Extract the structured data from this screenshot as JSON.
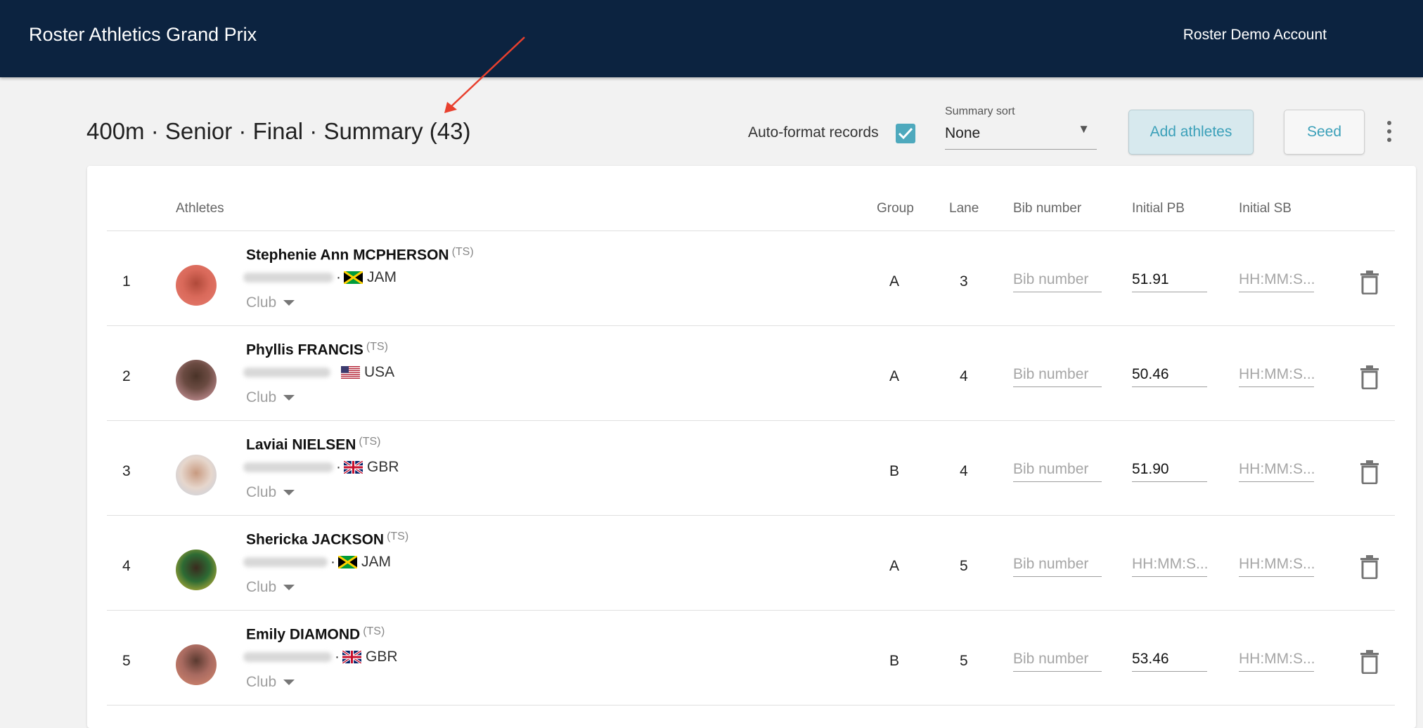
{
  "app": {
    "title": "Roster Athletics Grand Prix",
    "account": "Roster Demo Account"
  },
  "page": {
    "title": "400m · Senior · Final · Summary (43)"
  },
  "toolbar": {
    "autoformat_label": "Auto-format records",
    "autoformat_checked": true,
    "sort_label": "Summary sort",
    "sort_value": "None",
    "add_label": "Add athletes",
    "seed_label": "Seed"
  },
  "table": {
    "headers": {
      "athletes": "Athletes",
      "group": "Group",
      "lane": "Lane",
      "bib": "Bib number",
      "pb": "Initial PB",
      "sb": "Initial SB"
    },
    "placeholders": {
      "bib": "Bib number",
      "time": "HH:MM:S..."
    },
    "club_label": "Club",
    "ts_label": "(TS)",
    "separator": "·",
    "rows": [
      {
        "rank": "1",
        "name": "Stephenie Ann MCPHERSON",
        "country": "JAM",
        "flag": "jam-flag-icon",
        "group": "A",
        "lane": "3",
        "bib": "",
        "pb": "51.91",
        "sb": ""
      },
      {
        "rank": "2",
        "name": "Phyllis FRANCIS",
        "country": "USA",
        "flag": "usa-flag-icon",
        "group": "A",
        "lane": "4",
        "bib": "",
        "pb": "50.46",
        "sb": ""
      },
      {
        "rank": "3",
        "name": "Laviai NIELSEN",
        "country": "GBR",
        "flag": "gbr-flag-icon",
        "group": "B",
        "lane": "4",
        "bib": "",
        "pb": "51.90",
        "sb": ""
      },
      {
        "rank": "4",
        "name": "Shericka JACKSON",
        "country": "JAM",
        "flag": "jam-flag-icon",
        "group": "A",
        "lane": "5",
        "bib": "",
        "pb": "",
        "sb": ""
      },
      {
        "rank": "5",
        "name": "Emily DIAMOND",
        "country": "GBR",
        "flag": "gbr-flag-icon",
        "group": "B",
        "lane": "5",
        "bib": "",
        "pb": "53.46",
        "sb": ""
      }
    ]
  },
  "colors": {
    "header_bg": "#0c2340",
    "accent": "#3ba0b9",
    "checkbox": "#4ea9bd",
    "annotation_arrow": "#e8402e"
  }
}
